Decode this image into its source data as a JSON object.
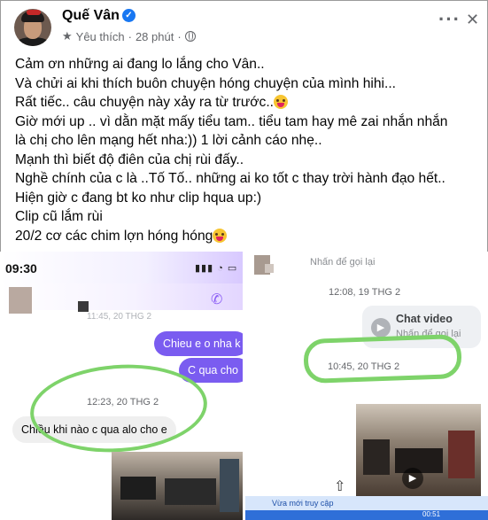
{
  "post": {
    "author": "Quế Vân",
    "verified_mark": "✓",
    "audience": "Yêu thích",
    "time": "28 phút",
    "separator": "·",
    "more_label": "···",
    "close_label": "✕",
    "lines": [
      "Cảm ơn những ai đang lo lắng cho Vân..",
      "Và chửi ai khi thích buôn chuyện hóng chuyện của mình hihi...",
      "Rất tiếc.. câu chuyện này xảy ra từ trước..",
      "Giờ mới up .. vì dằn mặt mấy tiểu tam.. tiểu tam hay mê zai nhắn nhắn",
      "là chị cho lên mạng hết nha:)) 1 lời cảnh cáo nhẹ..",
      "Mạnh thì biết độ điên của chị rùi đấy..",
      "Nghề chính của c là ..Tố Tố.. những ai ko tốt c thay trời hành đạo hết..",
      "Hiện giờ c đang bt ko như clip hqua up:)",
      "Clip cũ lắm rùi",
      "20/2 cơ các chim lợn hóng hóng"
    ]
  },
  "left_screenshot": {
    "time": "09:30",
    "status_icons": "▮▮▮ ◔ ▭",
    "faded_time": "11:45, 20 THG 2",
    "msg_out_1": "Chieu e o nha k",
    "msg_out_2": "C qua cho",
    "stamp": "12:23, 20 THG 2",
    "msg_in": "Chiều khi nào c qua alo cho e",
    "phone_icon": "✆"
  },
  "right_screenshot": {
    "callback": "Nhấn để gọi lại",
    "date_1": "12:08, 19 THG 2",
    "video_title": "Chat video",
    "video_sub": "Nhấn để gọi lại",
    "date_2": "10:45, 20 THG 2",
    "recent": "Vừa mới truy cập",
    "progress": "00:51",
    "cam_icon": "▶",
    "play_icon": "▶",
    "share_icon": "⇧"
  },
  "colors": {
    "messenger_purple": "#7a5cf0",
    "highlight_green": "#7ed36a",
    "fb_blue": "#1877f2"
  }
}
